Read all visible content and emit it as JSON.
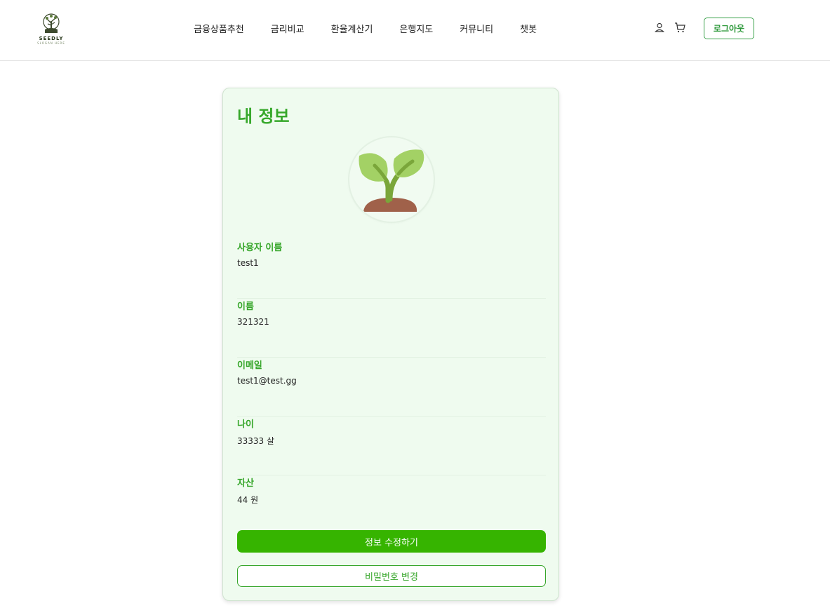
{
  "header": {
    "logo": {
      "name": "SEEDLY",
      "slogan": "SLOGAN HERE"
    },
    "nav": [
      {
        "label": "금융상품추천"
      },
      {
        "label": "금리비교"
      },
      {
        "label": "환율계산기"
      },
      {
        "label": "은행지도"
      },
      {
        "label": "커뮤니티"
      },
      {
        "label": "챗봇"
      }
    ],
    "icons": [
      "user-icon",
      "cart-icon"
    ],
    "logout_label": "로그아웃"
  },
  "profile": {
    "title": "내 정보",
    "avatar_icon": "sprout-icon",
    "fields": [
      {
        "label": "사용자 이름",
        "value": "test1"
      },
      {
        "label": "이름",
        "value": "321321"
      },
      {
        "label": "이메일",
        "value": "test1@test.gg"
      },
      {
        "label": "나이",
        "value": "33333 살"
      },
      {
        "label": "자산",
        "value": "44 원"
      }
    ],
    "edit_button": "정보 수정하기",
    "password_button": "비밀번호 변경"
  },
  "colors": {
    "accent": "#36b400",
    "label_green": "#36a62a",
    "card_bg": "#effbef"
  }
}
